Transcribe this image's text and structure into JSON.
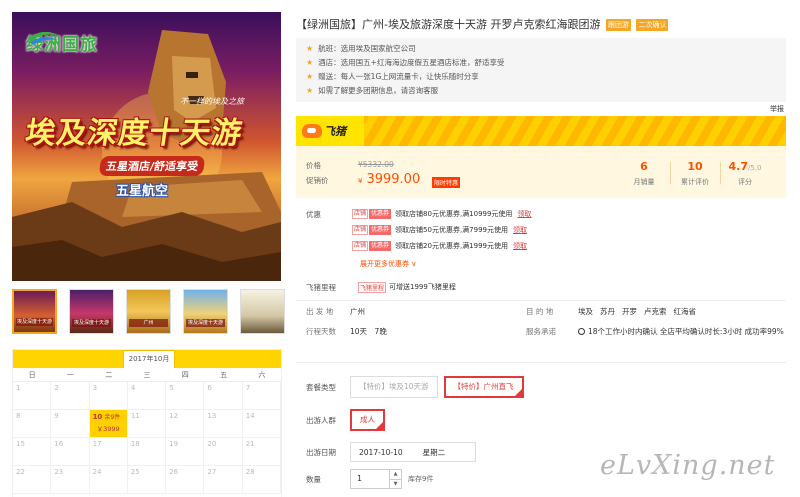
{
  "poster": {
    "brand": "绿洲国旅",
    "tagline": "不一样的埃及之旅",
    "title": "埃及深度十天游",
    "sub1": "五星酒店/舒适享受",
    "sub2": "五星航空"
  },
  "thumbnails": [
    {
      "label": "埃及深度十天游"
    },
    {
      "label": "埃及深度十天游"
    },
    {
      "label": "广州"
    },
    {
      "label": "埃及深度十天游"
    },
    {
      "label": ""
    }
  ],
  "calendar": {
    "month": "2017年10月",
    "weekdays": [
      "日",
      "一",
      "二",
      "三",
      "四",
      "五",
      "六"
    ],
    "rows": [
      [
        "1",
        "2",
        "3",
        "4",
        "5",
        "6",
        "7"
      ],
      [
        "8",
        "9",
        "10",
        "11",
        "12",
        "13",
        "14"
      ],
      [
        "15",
        "16",
        "17",
        "18",
        "19",
        "20",
        "21"
      ],
      [
        "22",
        "23",
        "24",
        "25",
        "26",
        "27",
        "28"
      ]
    ],
    "selected": {
      "day": "10",
      "count": "余9件",
      "price": "￥3999"
    }
  },
  "product": {
    "title": "【绿洲国旅】广州-埃及旅游深度十天游 开罗卢克索红海跟团游",
    "tag_follow": "跟团游",
    "tag_confirm": "二次确认"
  },
  "features": [
    "航班：选用埃及国家航空公司",
    "酒店：选用国五+红海海边度假五星酒店标准，舒适享受",
    "赠送：每人一张1G上网流量卡，让快乐随时分享",
    "如需了解更多团期信息，请咨询客服"
  ],
  "report": "举报",
  "fliggy": {
    "name": "飞猪"
  },
  "price": {
    "label_price": "价格",
    "original": "¥5332.00",
    "label_promo": "促销价",
    "currency": "¥",
    "current": "3999.00",
    "badge": "限时特惠",
    "stats": [
      {
        "value": "6",
        "suffix": "",
        "label": "月销量"
      },
      {
        "value": "10",
        "suffix": "",
        "label": "累计评价"
      },
      {
        "value": "4.7",
        "suffix": "/5.0",
        "label": "评分"
      }
    ]
  },
  "coupons": {
    "label": "优惠",
    "tag_shop": "店铺",
    "tag_coupon": "优惠券",
    "items": [
      {
        "text": "领取店铺80元优惠券,满10999元使用",
        "action": "领取"
      },
      {
        "text": "领取店铺50元优惠券,满7999元使用",
        "action": "领取"
      },
      {
        "text": "领取店铺20元优惠券,满1999元使用",
        "action": "领取"
      }
    ],
    "expand": "展开更多优惠券 ∨"
  },
  "mileage": {
    "label": "飞猪里程",
    "tag": "飞猪里程",
    "text": "可增送1999飞猪里程"
  },
  "info": {
    "depart_label": "出 发 地",
    "depart": "广州",
    "dest_label": "目 的 地",
    "dest": [
      "埃及",
      "苏丹",
      "开罗",
      "卢克索",
      "红海省"
    ],
    "days_label": "行程天数",
    "days": "10天　7晚",
    "promise_label": "服务承诺",
    "promise": "18个工作小时内确认 全店平均确认时长:3小时 成功率99%"
  },
  "options": {
    "type_label": "套餐类型",
    "types": [
      "【特价】埃及10天游",
      "【特价】广州直飞"
    ],
    "crowd_label": "出游人群",
    "crowd": "成人",
    "date_label": "出游日期",
    "date": "2017-10-10",
    "weekday": "星期二",
    "qty_label": "数量",
    "qty": "1",
    "stock": "库存9件"
  },
  "watermark": "eLvXing.net",
  "colors": {
    "accent": "#ff5000",
    "fliggy_yellow": "#ffe400",
    "coupon_red": "#e4393c"
  }
}
